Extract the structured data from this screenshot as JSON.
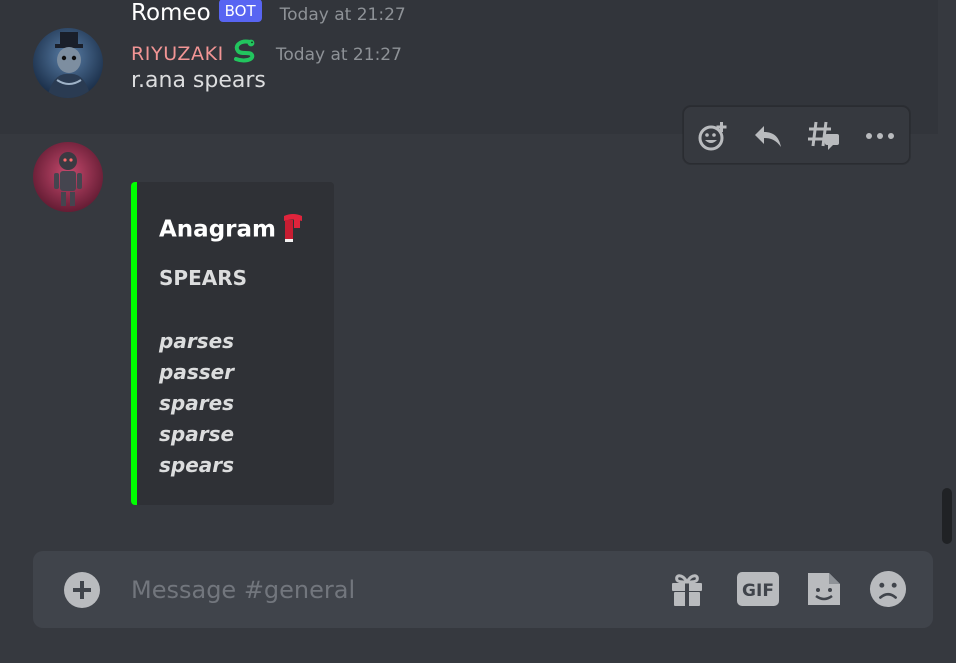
{
  "messages": [
    {
      "username": "RIYUZAKI",
      "badge_icon": "snake-icon",
      "timestamp": "Today at 21:27",
      "content": "r.ana spears"
    },
    {
      "username": "Romeo",
      "bot_tag": "BOT",
      "timestamp": "Today at 21:27",
      "embed": {
        "accent_color": "#00ff00",
        "title": "Anagram",
        "title_icon": "scarf-icon",
        "word": "SPEARS",
        "anagrams": [
          "parses",
          "passer",
          "spares",
          "sparse",
          "spears"
        ]
      }
    }
  ],
  "toolbar": {
    "icons": [
      "add-reaction-icon",
      "reply-icon",
      "create-thread-icon",
      "more-icon"
    ]
  },
  "composer": {
    "placeholder": "Message #general",
    "icons": [
      "add-attachment-icon",
      "gift-icon",
      "gif-icon",
      "sticker-icon",
      "emoji-icon"
    ],
    "gif_label": "GIF"
  },
  "colors": {
    "background": "#36393f",
    "username_riyuzaki": "#f29595",
    "bot_tag": "#5865f2",
    "embed_accent": "#00ff00"
  }
}
